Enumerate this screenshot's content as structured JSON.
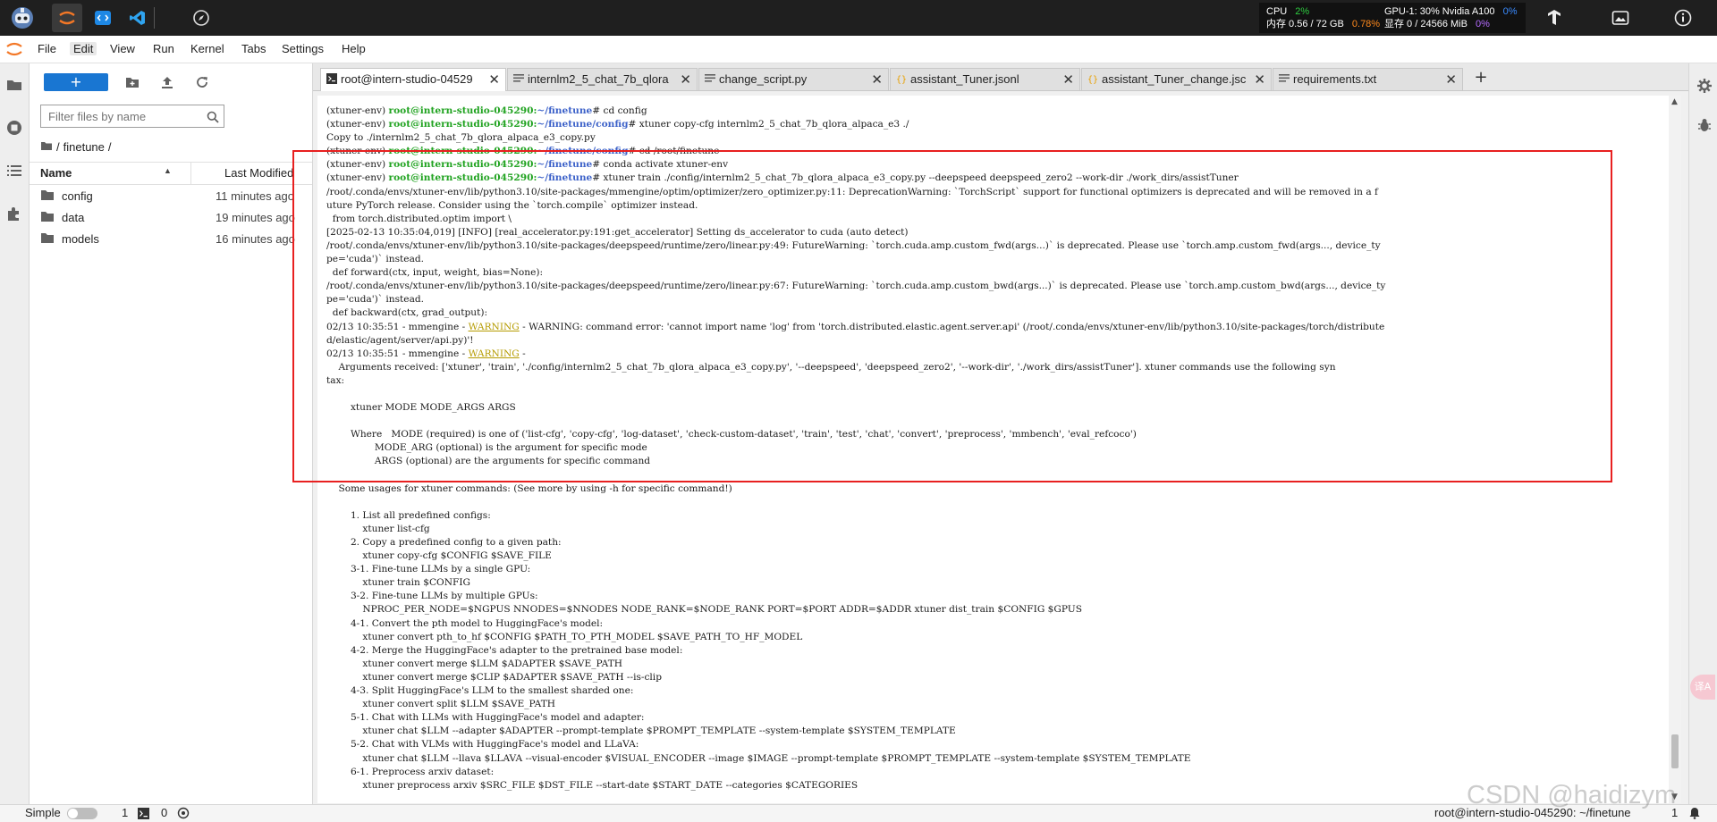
{
  "stats": {
    "cpu_label": "CPU",
    "cpu_value": "2%",
    "mem_label": "内存 0.56 / 72 GB",
    "mem_value": "0.78%",
    "gpu_label": "GPU-1: 30% Nvidia A100",
    "gpu_value": "0%",
    "vram_label": "显存 0 / 24566 MiB",
    "vram_value": "0%"
  },
  "menu": {
    "items": [
      "File",
      "Edit",
      "View",
      "Run",
      "Kernel",
      "Tabs",
      "Settings",
      "Help"
    ]
  },
  "filebrowser": {
    "new_label": "+",
    "filter_placeholder": "Filter files by name",
    "breadcrumb_root": "/",
    "breadcrumb_folder": "finetune",
    "breadcrumb_sep": "/",
    "col_name": "Name",
    "col_modified": "Last Modified",
    "items": [
      {
        "name": "config",
        "modified": "11 minutes ago"
      },
      {
        "name": "data",
        "modified": "19 minutes ago"
      },
      {
        "name": "models",
        "modified": "16 minutes ago"
      }
    ]
  },
  "tabs": [
    {
      "label": "root@intern-studio-04529"
    },
    {
      "label": "internlm2_5_chat_7b_qlora"
    },
    {
      "label": "change_script.py"
    },
    {
      "label": "assistant_Tuner.jsonl"
    },
    {
      "label": "assistant_Tuner_change.jsc"
    },
    {
      "label": "requirements.txt"
    }
  ],
  "terminal": {
    "env": "(xtuner-env)",
    "prompt_user": "root@intern-studio-045290:",
    "path_finetune": "~/finetune",
    "path_config": "~/finetune/config",
    "cmd_cd_config": "# cd config",
    "cmd_copy_cfg": "# xtuner copy-cfg internlm2_5_chat_7b_qlora_alpaca_e3 ./",
    "out_copy": "Copy to ./internlm2_5_chat_7b_qlora_alpaca_e3_copy.py",
    "cmd_cd_root": "# cd /root/finetune",
    "cmd_conda": "# conda activate xtuner-env",
    "cmd_train": "# xtuner train ./config/internlm2_5_chat_7b_qlora_alpaca_e3_copy.py --deepspeed deepspeed_zero2 --work-dir ./work_dirs/assistTuner",
    "warn_word": "WARNING",
    "out1": [
      "/root/.conda/envs/xtuner-env/lib/python3.10/site-packages/mmengine/optim/optimizer/zero_optimizer.py:11: DeprecationWarning: `TorchScript` support for functional optimizers is deprecated and will be removed in a f",
      "uture PyTorch release. Consider using the `torch.compile` optimizer instead.",
      "  from torch.distributed.optim import \\",
      "[2025-02-13 10:35:04,019] [INFO] [real_accelerator.py:191:get_accelerator] Setting ds_accelerator to cuda (auto detect)",
      "/root/.conda/envs/xtuner-env/lib/python3.10/site-packages/deepspeed/runtime/zero/linear.py:49: FutureWarning: `torch.cuda.amp.custom_fwd(args...)` is deprecated. Please use `torch.amp.custom_fwd(args..., device_ty",
      "pe='cuda')` instead.",
      "  def forward(ctx, input, weight, bias=None):",
      "/root/.conda/envs/xtuner-env/lib/python3.10/site-packages/deepspeed/runtime/zero/linear.py:67: FutureWarning: `torch.cuda.amp.custom_bwd(args...)` is deprecated. Please use `torch.amp.custom_bwd(args..., device_ty",
      "pe='cuda')` instead.",
      "  def backward(ctx, grad_output):"
    ],
    "warn1_prefix": "02/13 10:35:51 - mmengine - ",
    "warn1_suffix": " - WARNING: command error: 'cannot import name 'log' from 'torch.distributed.elastic.agent.server.api' (/root/.conda/envs/xtuner-env/lib/python3.10/site-packages/torch/distribute",
    "warn1_cont": "d/elastic/agent/server/api.py)'!",
    "warn2_prefix": "02/13 10:35:51 - mmengine - ",
    "warn2_suffix": " -",
    "out2": [
      "    Arguments received: ['xtuner', 'train', './config/internlm2_5_chat_7b_qlora_alpaca_e3_copy.py', '--deepspeed', 'deepspeed_zero2', '--work-dir', './work_dirs/assistTuner']. xtuner commands use the following syn",
      "tax:",
      "",
      "        xtuner MODE MODE_ARGS ARGS",
      "",
      "        Where   MODE (required) is one of ('list-cfg', 'copy-cfg', 'log-dataset', 'check-custom-dataset', 'train', 'test', 'chat', 'convert', 'preprocess', 'mmbench', 'eval_refcoco')",
      "                MODE_ARG (optional) is the argument for specific mode",
      "                ARGS (optional) are the arguments for specific command",
      "",
      "    Some usages for xtuner commands: (See more by using -h for specific command!)",
      "",
      "        1. List all predefined configs:",
      "            xtuner list-cfg",
      "        2. Copy a predefined config to a given path:",
      "            xtuner copy-cfg $CONFIG $SAVE_FILE",
      "        3-1. Fine-tune LLMs by a single GPU:",
      "            xtuner train $CONFIG",
      "        3-2. Fine-tune LLMs by multiple GPUs:",
      "            NPROC_PER_NODE=$NGPUS NNODES=$NNODES NODE_RANK=$NODE_RANK PORT=$PORT ADDR=$ADDR xtuner dist_train $CONFIG $GPUS",
      "        4-1. Convert the pth model to HuggingFace's model:",
      "            xtuner convert pth_to_hf $CONFIG $PATH_TO_PTH_MODEL $SAVE_PATH_TO_HF_MODEL",
      "        4-2. Merge the HuggingFace's adapter to the pretrained base model:",
      "            xtuner convert merge $LLM $ADAPTER $SAVE_PATH",
      "            xtuner convert merge $CLIP $ADAPTER $SAVE_PATH --is-clip",
      "        4-3. Split HuggingFace's LLM to the smallest sharded one:",
      "            xtuner convert split $LLM $SAVE_PATH",
      "        5-1. Chat with LLMs with HuggingFace's model and adapter:",
      "            xtuner chat $LLM --adapter $ADAPTER --prompt-template $PROMPT_TEMPLATE --system-template $SYSTEM_TEMPLATE",
      "        5-2. Chat with VLMs with HuggingFace's model and LLaVA:",
      "            xtuner chat $LLM --llava $LLAVA --visual-encoder $VISUAL_ENCODER --image $IMAGE --prompt-template $PROMPT_TEMPLATE --system-template $SYSTEM_TEMPLATE",
      "        6-1. Preprocess arxiv dataset:",
      "            xtuner preprocess arxiv $SRC_FILE $DST_FILE --start-date $START_DATE --categories $CATEGORIES"
    ]
  },
  "statusbar": {
    "mode_label": "Simple",
    "count1": "1",
    "count2": "0",
    "right_text": "root@intern-studio-045290: ~/finetune",
    "right_count": "1"
  },
  "translate_badge": "译A",
  "watermark": "CSDN @haidizym",
  "colors": {
    "accent": "#1976d2",
    "highlight": "#e82020",
    "prompt_green": "#21a321",
    "prompt_blue": "#3d62c9",
    "warning": "#b59b00"
  }
}
